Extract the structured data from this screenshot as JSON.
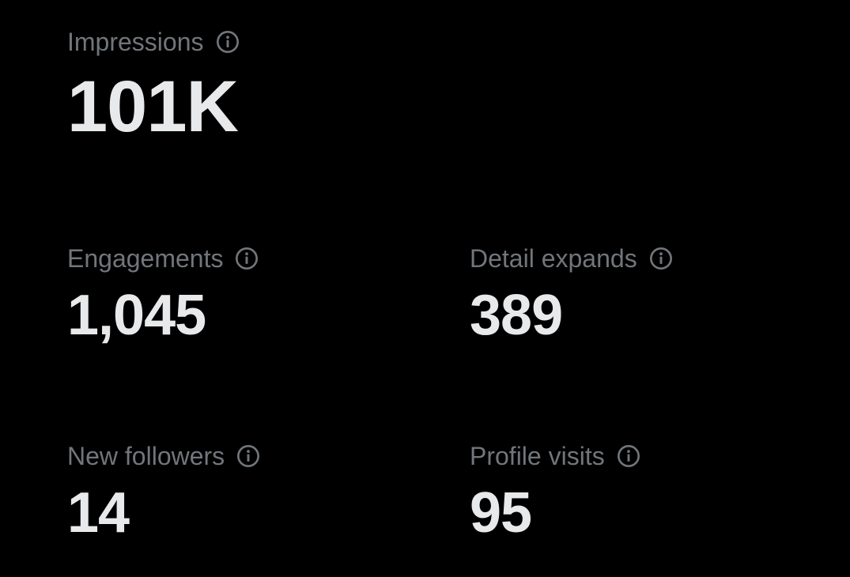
{
  "metrics": {
    "impressions": {
      "label": "Impressions",
      "value": "101K",
      "icon": "info-icon"
    },
    "engagements": {
      "label": "Engagements",
      "value": "1,045",
      "icon": "info-icon"
    },
    "detail_expands": {
      "label": "Detail expands",
      "value": "389",
      "icon": "info-icon"
    },
    "new_followers": {
      "label": "New followers",
      "value": "14",
      "icon": "info-icon"
    },
    "profile_visits": {
      "label": "Profile visits",
      "value": "95",
      "icon": "info-icon"
    }
  },
  "colors": {
    "background": "#000000",
    "label": "#71767b",
    "value": "#e7e9ea"
  }
}
